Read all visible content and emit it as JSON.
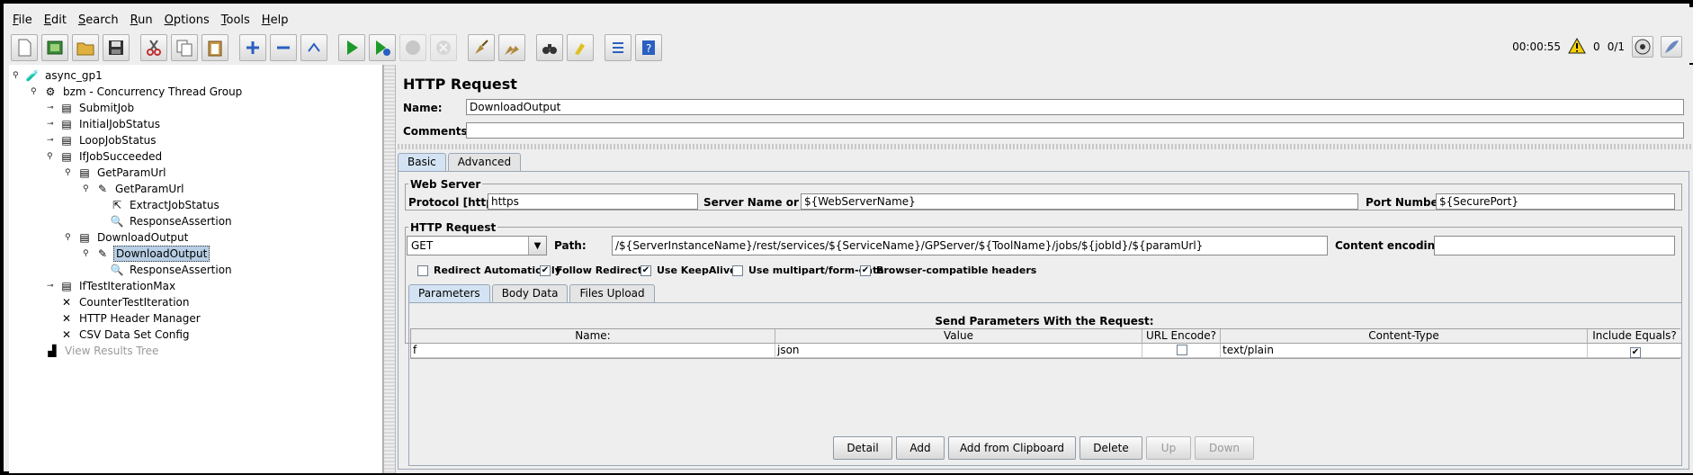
{
  "menu": [
    "File",
    "Edit",
    "Search",
    "Run",
    "Options",
    "Tools",
    "Help"
  ],
  "status": {
    "elapsed": "00:00:55",
    "warnings": "0",
    "threads": "0/1"
  },
  "tree": {
    "n0": "async_gp1",
    "n1": "bzm - Concurrency Thread Group",
    "n2": "SubmitJob",
    "n3": "InitialJobStatus",
    "n4": "LoopJobStatus",
    "n5": "IfJobSucceeded",
    "n6": "GetParamUrl",
    "n7": "GetParamUrl",
    "n8": "ExtractJobStatus",
    "n9": "ResponseAssertion",
    "n10": "DownloadOutput",
    "n11": "DownloadOutput",
    "n12": "ResponseAssertion",
    "n13": "IfTestIterationMax",
    "n14": "CounterTestIteration",
    "n15": "HTTP Header Manager",
    "n16": "CSV Data Set Config",
    "n17": "View Results Tree"
  },
  "panel": {
    "title": "HTTP Request",
    "name_label": "Name:",
    "name_value": "DownloadOutput",
    "comments_label": "Comments:",
    "comments_value": "",
    "tabs": [
      "Basic",
      "Advanced"
    ],
    "web_server": {
      "section": "Web Server",
      "protocol_label": "Protocol [http]:",
      "protocol_value": "https",
      "server_label": "Server Name or IP:",
      "server_value": "${WebServerName}",
      "port_label": "Port Number:",
      "port_value": "${SecurePort}"
    },
    "http_request": {
      "section": "HTTP Request",
      "method": "GET",
      "path_label": "Path:",
      "path_value": "/${ServerInstanceName}/rest/services/${ServiceName}/GPServer/${ToolName}/jobs/${jobId}/${paramUrl}",
      "encoding_label": "Content encoding:",
      "encoding_value": ""
    },
    "options": [
      {
        "label": "Redirect Automatically",
        "checked": false
      },
      {
        "label": "Follow Redirects",
        "checked": true
      },
      {
        "label": "Use KeepAlive",
        "checked": true
      },
      {
        "label": "Use multipart/form-data",
        "checked": false
      },
      {
        "label": "Browser-compatible headers",
        "checked": true
      }
    ],
    "subtabs": [
      "Parameters",
      "Body Data",
      "Files Upload"
    ],
    "params": {
      "heading": "Send Parameters With the Request:",
      "columns": [
        "Name:",
        "Value",
        "URL Encode?",
        "Content-Type",
        "Include Equals?"
      ],
      "rows": [
        {
          "name": "f",
          "value": "json",
          "url_encode": false,
          "content_type": "text/plain",
          "include_equals": true
        }
      ]
    },
    "buttons": [
      "Detail",
      "Add",
      "Add from Clipboard",
      "Delete",
      "Up",
      "Down"
    ]
  }
}
